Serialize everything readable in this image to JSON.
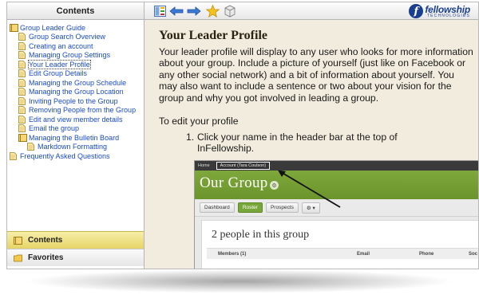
{
  "topbar": {
    "contents_label": "Contents",
    "logo_mark": "f",
    "logo_name": "fellowship",
    "logo_sub": "TECHNOLOGIES"
  },
  "toc": {
    "items": [
      {
        "label": "Group Leader Guide",
        "level": 0,
        "icon": "book-icon"
      },
      {
        "label": "Group Search Overview",
        "level": 1,
        "icon": "page-icon"
      },
      {
        "label": "Creating an account",
        "level": 1,
        "icon": "page-icon"
      },
      {
        "label": "Managing Group Settings",
        "level": 1,
        "icon": "page-icon"
      },
      {
        "label": "Your Leader Profile",
        "level": 1,
        "icon": "page-icon",
        "selected": true
      },
      {
        "label": "Edit Group Details",
        "level": 1,
        "icon": "page-icon"
      },
      {
        "label": "Managing the Group Schedule",
        "level": 1,
        "icon": "page-icon"
      },
      {
        "label": "Managing the Group Location",
        "level": 1,
        "icon": "page-icon"
      },
      {
        "label": "Inviting People to the Group",
        "level": 1,
        "icon": "page-icon"
      },
      {
        "label": "Removing People from the Group",
        "level": 1,
        "icon": "page-icon"
      },
      {
        "label": "Edit and view member details",
        "level": 1,
        "icon": "page-icon"
      },
      {
        "label": "Email the group",
        "level": 1,
        "icon": "page-icon"
      },
      {
        "label": "Managing the Bulletin Board",
        "level": 1,
        "icon": "book-icon"
      },
      {
        "label": "Markdown Formatting",
        "level": 2,
        "icon": "page-icon"
      },
      {
        "label": "Frequently Asked Questions",
        "level": 0,
        "icon": "page-icon"
      }
    ]
  },
  "nav": {
    "contents_label": "Contents",
    "favorites_label": "Favorites"
  },
  "content": {
    "title": "Your Leader Profile",
    "paragraph": "Your leader profile will display to any user who looks for more information about your group. Include a picture of yourself (just like on Facebook or any other social network) and a bit of information about yourself.  You may also want to include a sentence or two about your vision for the group and why you got involved in leading a group.",
    "subheading": "To edit your profile",
    "step_number": "1.",
    "step_text": "Click your name in the header bar at the top of InFellowship."
  },
  "screenshot": {
    "home_label": "Home",
    "account_label": "Account (Tara Coulson)",
    "group_title": "Our Group",
    "tabs": [
      "Dashboard",
      "Roster",
      "Prospects"
    ],
    "active_tab": "Roster",
    "people_count_text": "2 people in this group",
    "columns": [
      "Members (1)",
      "Email",
      "Phone",
      "Soc"
    ]
  },
  "colors": {
    "content_bg": "#f1ecdd",
    "link": "#1a4bc4",
    "green": "#79a63a",
    "contents_tab": "#e6d466"
  }
}
